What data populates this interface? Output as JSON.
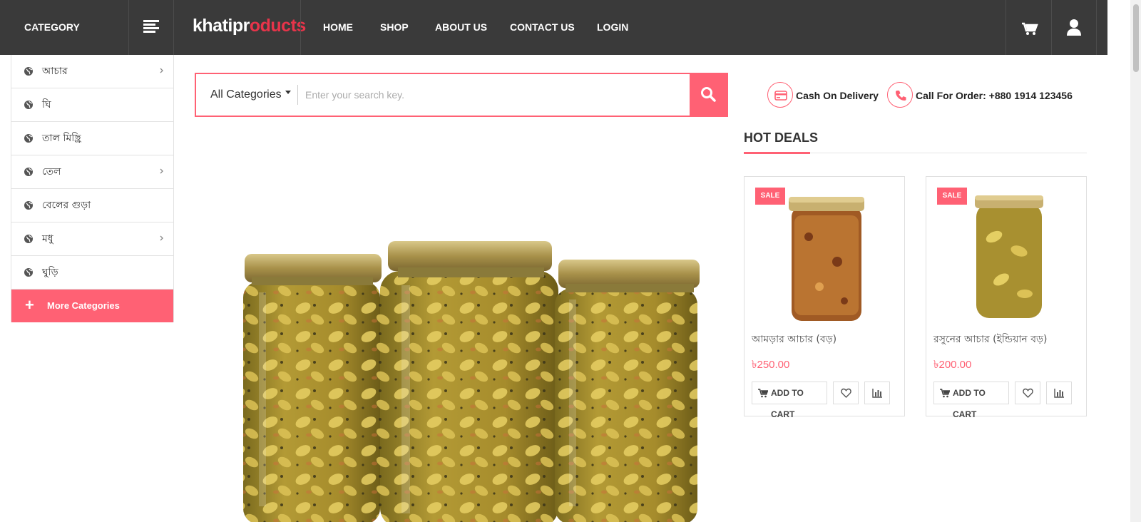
{
  "header": {
    "category_label": "CATEGORY",
    "logo_white": "khatipr",
    "logo_red": "oducts",
    "nav": [
      "HOME",
      "SHOP",
      "ABOUT US",
      "CONTACT US",
      "LOGIN"
    ]
  },
  "sidebar": {
    "items": [
      {
        "label": "আচার",
        "has_children": true
      },
      {
        "label": "ঘি",
        "has_children": false
      },
      {
        "label": "তাল মিছ্রি",
        "has_children": false
      },
      {
        "label": "তেল",
        "has_children": true
      },
      {
        "label": "বেলের গুড়া",
        "has_children": false
      },
      {
        "label": "মধু",
        "has_children": true
      },
      {
        "label": "ঘুড়ি",
        "has_children": false
      }
    ],
    "more_label": "More Categories",
    "more_icon": "+"
  },
  "search": {
    "category": "All Categories",
    "placeholder": "Enter your search key."
  },
  "info": {
    "cod": "Cash On Delivery",
    "call": "Call For Order: +880 1914 123456"
  },
  "hot_deals": {
    "title": "HOT DEALS",
    "products": [
      {
        "badge": "SALE",
        "name": "আমড়ার আচার (বড়)",
        "price": "৳250.00",
        "add_to_cart": "ADD TO CART"
      },
      {
        "badge": "SALE",
        "name": "রসুনের আচার (ইন্ডিয়ান বড়)",
        "price": "৳200.00",
        "add_to_cart": "ADD TO CART"
      }
    ]
  },
  "colors": {
    "accent": "#ff6174",
    "header_bg": "#3a3a3a",
    "logo_red": "#e8344a"
  }
}
